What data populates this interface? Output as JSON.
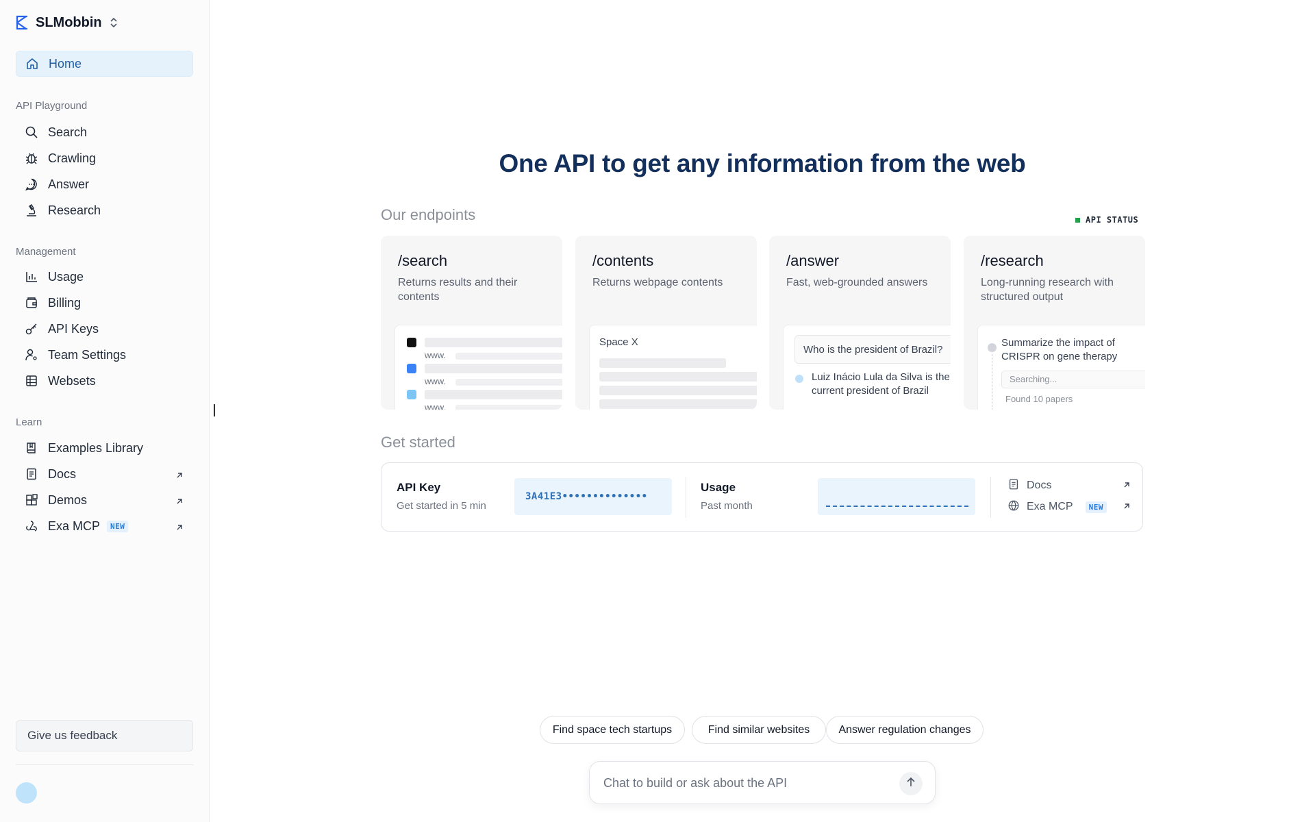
{
  "app": {
    "org_name": "SLMobbin"
  },
  "sidebar": {
    "home": {
      "label": "Home",
      "icon": "home-icon"
    },
    "sections": [
      {
        "label": "API Playground"
      },
      {
        "label": "Management"
      },
      {
        "label": "Learn"
      }
    ],
    "playground": [
      {
        "label": "Search",
        "icon": "search-icon"
      },
      {
        "label": "Crawling",
        "icon": "bug-icon"
      },
      {
        "label": "Answer",
        "icon": "chat-bubble-icon"
      },
      {
        "label": "Research",
        "icon": "microscope-icon"
      }
    ],
    "management": [
      {
        "label": "Usage",
        "icon": "bar-chart-icon"
      },
      {
        "label": "Billing",
        "icon": "wallet-icon"
      },
      {
        "label": "API Keys",
        "icon": "key-icon"
      },
      {
        "label": "Team Settings",
        "icon": "user-gear-icon"
      },
      {
        "label": "Websets",
        "icon": "grid-table-icon"
      }
    ],
    "learn": [
      {
        "label": "Examples Library",
        "icon": "book-icon"
      },
      {
        "label": "Docs",
        "icon": "document-icon"
      },
      {
        "label": "Demos",
        "icon": "blocks-icon"
      },
      {
        "label": "Exa MCP",
        "icon": "webhook-icon",
        "badge": "NEW"
      }
    ],
    "feedback_label": "Give us feedback"
  },
  "main": {
    "headline": "One API to get any information from the web",
    "endpoints_title": "Our endpoints",
    "api_status_label": "API STATUS",
    "cards": [
      {
        "title": "/search",
        "desc": "Returns results and their contents",
        "www": "www."
      },
      {
        "title": "/contents",
        "desc": "Returns webpage contents",
        "preview_title": "Space X"
      },
      {
        "title": "/answer",
        "desc": "Fast, web-grounded answers",
        "question": "Who is the president of Brazil?",
        "answer": "Luiz Inácio Lula da Silva is the current president of Brazil"
      },
      {
        "title": "/research",
        "desc": "Long-running research with structured output",
        "prompt": "Summarize the impact of CRISPR on gene therapy",
        "searching": "Searching...",
        "found": "Found 10 papers"
      }
    ],
    "get_started_title": "Get started",
    "get_started": {
      "api_key_label": "API Key",
      "api_key_sub": "Get started in 5 min",
      "api_key_masked": "3A41E3••••••••••••••",
      "usage_label": "Usage",
      "usage_sub": "Past month",
      "links": [
        {
          "label": "Docs"
        },
        {
          "label": "Exa MCP",
          "badge": "NEW"
        }
      ]
    },
    "suggestions": [
      "Find space tech startups",
      "Find similar websites",
      "Answer regulation changes"
    ],
    "chat_placeholder": "Chat to build or ask about the API"
  },
  "colors": {
    "accent": "#1f5fa6",
    "headline": "#132f5c",
    "status_ok": "#22a04b",
    "brand_logo": "#2563eb"
  }
}
